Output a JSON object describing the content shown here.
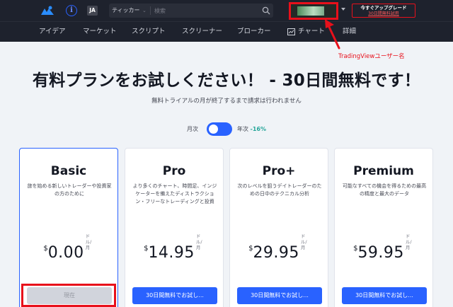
{
  "colors": {
    "topbar_bg": "#1e222d",
    "accent": "#2962ff",
    "annotation": "#e8101b",
    "discount": "#26a69a"
  },
  "icons": {
    "logo": "tradingview-cloud-logo",
    "info": "info-circle-icon",
    "search": "magnifier-icon",
    "chart": "line-chart-icon"
  },
  "header": {
    "language": "JA",
    "search": {
      "ticker_label": "ティッカー",
      "placeholder": "検索"
    },
    "upgrade": {
      "line1": "今すぐアップグレード",
      "line2": "30日間無料試用"
    }
  },
  "nav": {
    "items": [
      {
        "label": "アイデア"
      },
      {
        "label": "マーケット"
      },
      {
        "label": "スクリプト"
      },
      {
        "label": "スクリーナー"
      },
      {
        "label": "ブローカー"
      },
      {
        "label": "チャート"
      },
      {
        "label": "詳細"
      }
    ]
  },
  "annotation": {
    "label": "TradingViewユーザー名"
  },
  "hero": {
    "title": "有料プランをお試しください！ - 30日間無料です！",
    "subtitle": "無料トライアルの月が終了するまで請求は行われません"
  },
  "billing": {
    "monthly": "月次",
    "yearly": "年次",
    "discount": "-16%",
    "selected": "monthly"
  },
  "plans": [
    {
      "name": "Basic",
      "description": "旅を始める新しいトレーダーや投資家の方のために",
      "currency": "$",
      "price": "0.00",
      "unit": "ドル/月",
      "cta": "現在",
      "current": true
    },
    {
      "name": "Pro",
      "description": "より多くのチャート、時間足、インジケーターを備えたディストラクション・フリーなトレーディングと投資",
      "currency": "$",
      "price": "14.95",
      "unit": "ドル/月",
      "cta": "30日間無料でお試し...",
      "current": false
    },
    {
      "name": "Pro+",
      "description": "次のレベルを狙うデイトレーダーのための日中のテクニカル分析",
      "currency": "$",
      "price": "29.95",
      "unit": "ドル/月",
      "cta": "30日間無料でお試し...",
      "current": false
    },
    {
      "name": "Premium",
      "description": "可能なすべての機会を得るための最高の精度と最大のデータ",
      "currency": "$",
      "price": "59.95",
      "unit": "ドル/月",
      "cta": "30日間無料でお試し...",
      "current": false
    }
  ]
}
